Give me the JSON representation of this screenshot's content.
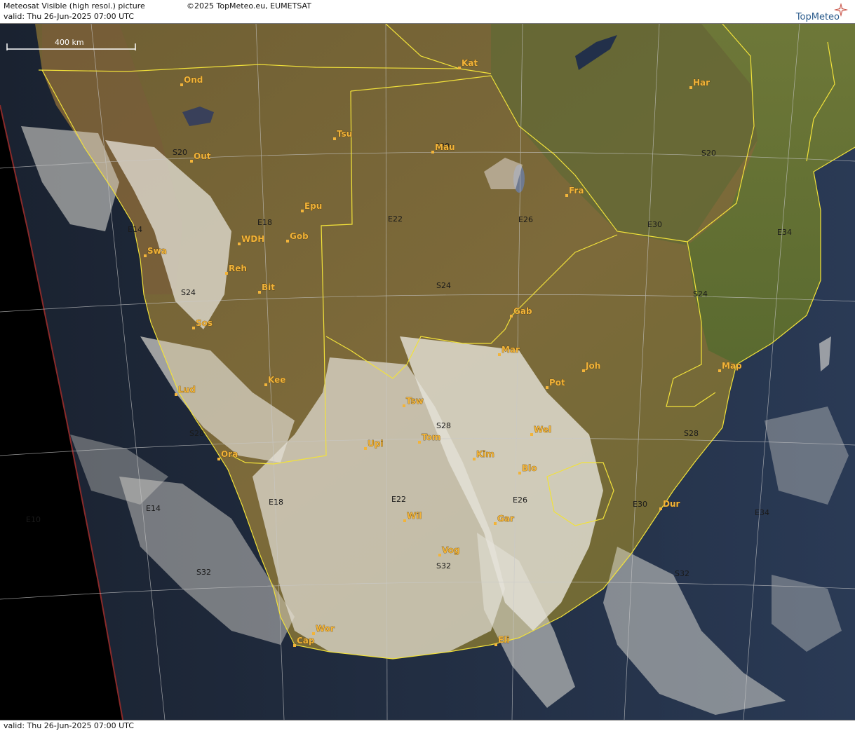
{
  "header": {
    "title": "Meteosat Visible (high resol.) picture",
    "copyright": "©2025 TopMeteo.eu, EUMETSAT",
    "valid": "valid:  Thu  26-Jun-2025  07:00 UTC",
    "brand": "TopMeteo"
  },
  "footer": {
    "valid": "valid:  Thu  26-Jun-2025  07:00 UTC"
  },
  "scale": {
    "label": "400 km"
  },
  "colors": {
    "land": "#7b6a3a",
    "ocean": "#1f2a3c",
    "border": "#f2e23a",
    "grid": "#c9c9c9",
    "city_label": "#f2b43a",
    "cloud": "#e8e6df"
  },
  "cities": [
    {
      "name": "Ond"
    },
    {
      "name": "Kat"
    },
    {
      "name": "Har"
    },
    {
      "name": "Tsu"
    },
    {
      "name": "Mau"
    },
    {
      "name": "Out"
    },
    {
      "name": "Fra"
    },
    {
      "name": "Epu"
    },
    {
      "name": "WDH"
    },
    {
      "name": "Gob"
    },
    {
      "name": "Swa"
    },
    {
      "name": "Reh"
    },
    {
      "name": "Bit"
    },
    {
      "name": "Sos"
    },
    {
      "name": "Gab"
    },
    {
      "name": "Mar"
    },
    {
      "name": "Joh"
    },
    {
      "name": "Map"
    },
    {
      "name": "Kee"
    },
    {
      "name": "Pot"
    },
    {
      "name": "Lud"
    },
    {
      "name": "Tsw"
    },
    {
      "name": "Wel"
    },
    {
      "name": "Tom"
    },
    {
      "name": "Upi"
    },
    {
      "name": "Kim"
    },
    {
      "name": "Blo"
    },
    {
      "name": "Ora"
    },
    {
      "name": "Dur"
    },
    {
      "name": "Wil"
    },
    {
      "name": "Gar"
    },
    {
      "name": "Vog"
    },
    {
      "name": "Wor"
    },
    {
      "name": "Cap"
    },
    {
      "name": "Eli"
    }
  ],
  "grid_labels": [
    {
      "text": "S20"
    },
    {
      "text": "S20"
    },
    {
      "text": "S20"
    },
    {
      "text": "S24"
    },
    {
      "text": "S24"
    },
    {
      "text": "S24"
    },
    {
      "text": "S28"
    },
    {
      "text": "S28"
    },
    {
      "text": "S28"
    },
    {
      "text": "S32"
    },
    {
      "text": "S32"
    },
    {
      "text": "S32"
    },
    {
      "text": "E14"
    },
    {
      "text": "E18"
    },
    {
      "text": "E22"
    },
    {
      "text": "E26"
    },
    {
      "text": "E30"
    },
    {
      "text": "E34"
    },
    {
      "text": "E10"
    },
    {
      "text": "E14"
    },
    {
      "text": "E18"
    },
    {
      "text": "E22"
    },
    {
      "text": "E26"
    },
    {
      "text": "E30"
    },
    {
      "text": "E34"
    }
  ]
}
